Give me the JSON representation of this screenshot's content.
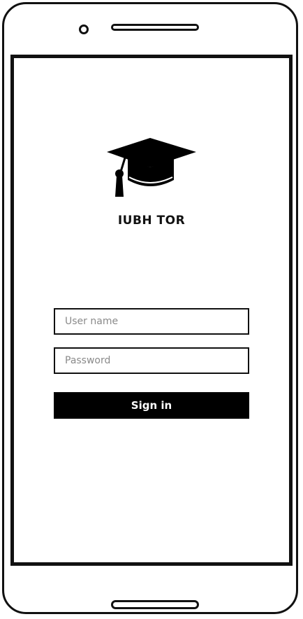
{
  "app": {
    "title": "IUBH TOR",
    "logo_icon": "graduation-cap-icon"
  },
  "login_form": {
    "username_placeholder": "User name",
    "username_value": "",
    "password_placeholder": "Password",
    "password_value": "",
    "signin_label": "Sign in"
  },
  "colors": {
    "accent": "#000000",
    "background": "#ffffff",
    "placeholder": "#8a8a8a"
  }
}
